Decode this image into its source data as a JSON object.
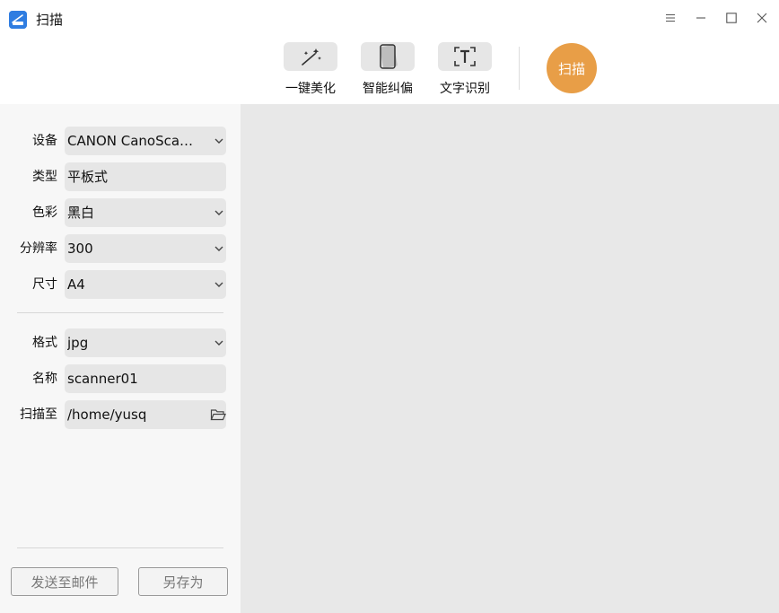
{
  "window": {
    "title": "扫描",
    "icons": {
      "app": "scanner-app-icon",
      "menu": "menu-icon",
      "minimize": "minimize-icon",
      "maximize": "maximize-icon",
      "close": "close-icon"
    }
  },
  "toolbar": {
    "tools": [
      {
        "label": "一键美化",
        "icon": "magic-wand-icon"
      },
      {
        "label": "智能纠偏",
        "icon": "deskew-icon"
      },
      {
        "label": "文字识别",
        "icon": "text-recognition-icon"
      }
    ],
    "scan_label": "扫描",
    "accent_color": "#e89e47"
  },
  "settings": {
    "device": {
      "label": "设备",
      "value": "CANON CanoSca…"
    },
    "type": {
      "label": "类型",
      "value": "平板式"
    },
    "color": {
      "label": "色彩",
      "value": "黑白"
    },
    "resolution": {
      "label": "分辨率",
      "value": "300"
    },
    "size": {
      "label": "尺寸",
      "value": "A4"
    },
    "format": {
      "label": "格式",
      "value": "jpg"
    },
    "name": {
      "label": "名称",
      "value": "scanner01"
    },
    "scan_to": {
      "label": "扫描至",
      "value": "/home/yusq",
      "icon": "folder-open-icon"
    }
  },
  "actions": {
    "send_email": "发送至邮件",
    "save_as": "另存为"
  }
}
